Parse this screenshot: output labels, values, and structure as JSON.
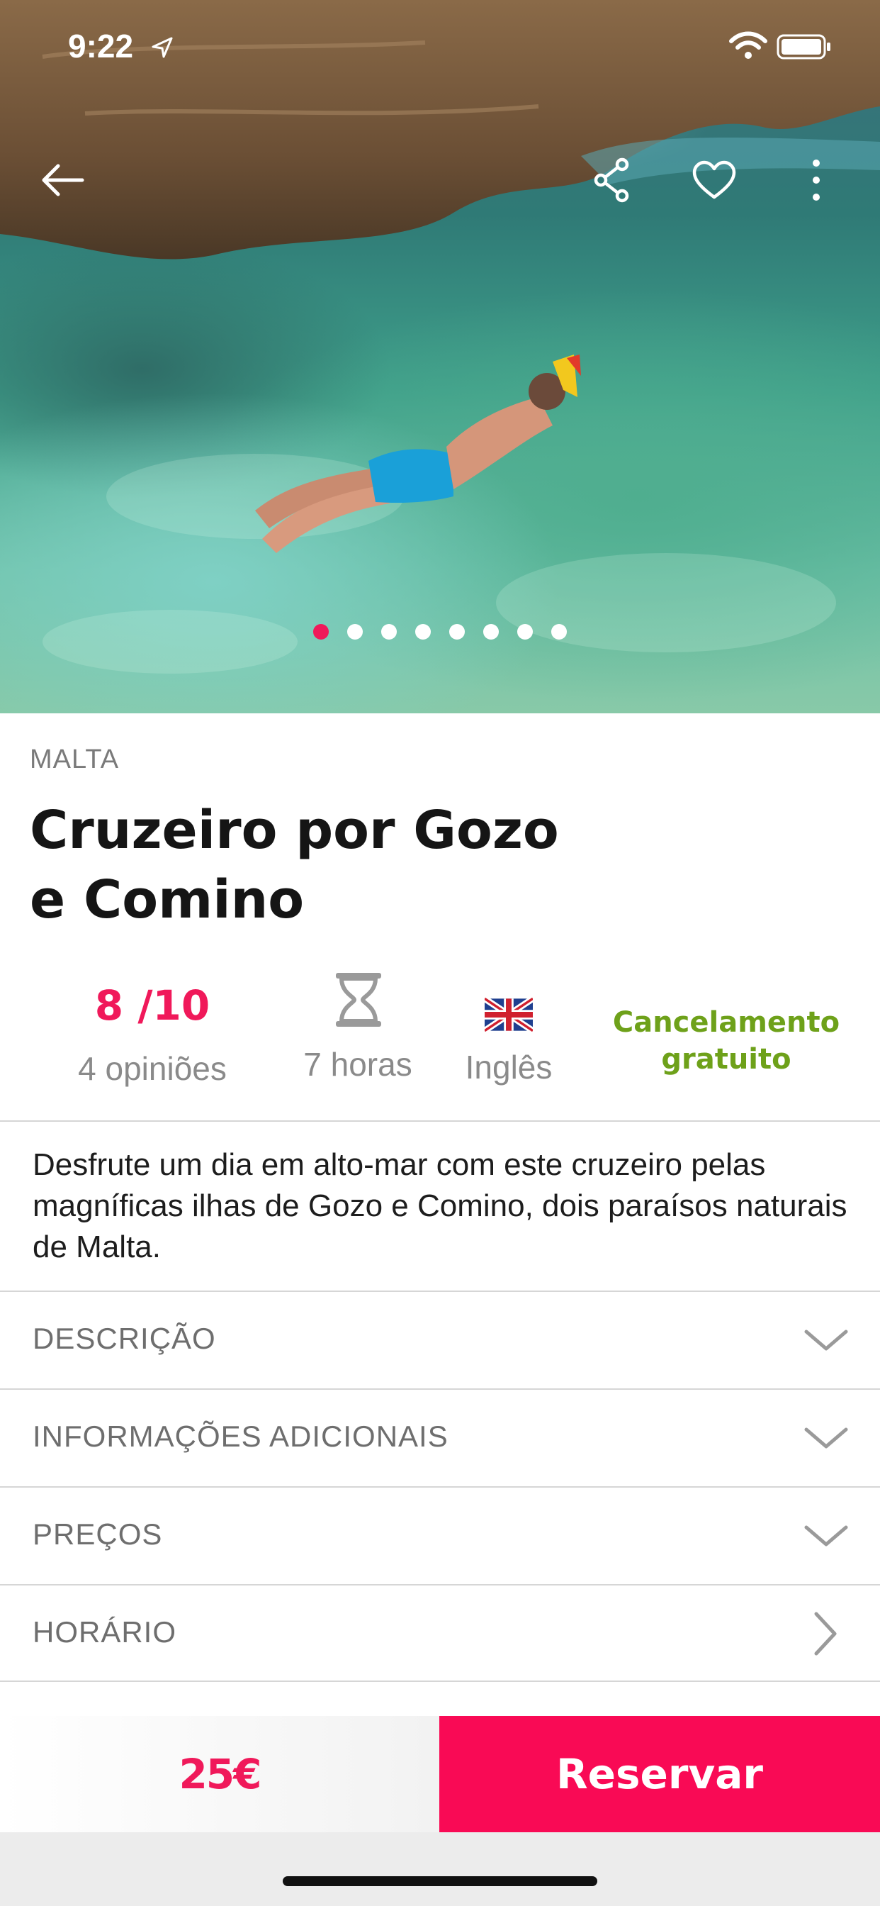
{
  "status_bar": {
    "time": "9:22"
  },
  "hero": {
    "icons": [
      "back-arrow-icon",
      "share-icon",
      "heart-icon",
      "more-vertical-icon"
    ],
    "gallery": {
      "count": 8,
      "active_index": 0
    },
    "colors": {
      "active_dot": "#f0195a",
      "inactive_dot": "#ffffff"
    }
  },
  "tour": {
    "country": "MALTA",
    "title_line1": "Cruzeiro por Gozo",
    "title_line2": "e Comino",
    "rating_score": "8 /10",
    "rating_count": "4 opiniões",
    "duration": "7 horas",
    "language": "Inglês",
    "cancellation_line1": "Cancelamento",
    "cancellation_line2": "gratuito",
    "summary": "Desfrute um dia em alto-mar com este cruzeiro pelas magníficas ilhas de Gozo e Comino, dois paraísos naturais de Malta."
  },
  "sections": [
    {
      "label": "DESCRIÇÃO",
      "icon": "chevron-down-icon"
    },
    {
      "label": "INFORMAÇÕES ADICIONAIS",
      "icon": "chevron-down-icon"
    },
    {
      "label": "PREÇOS",
      "icon": "chevron-down-icon"
    },
    {
      "label": "HORÁRIO",
      "icon": "chevron-right-icon"
    }
  ],
  "booking": {
    "price": "25€",
    "button_label": "Reservar",
    "colors": {
      "accent": "#f90a55",
      "price": "#f0195a",
      "cancellation": "#6ea11a"
    }
  }
}
